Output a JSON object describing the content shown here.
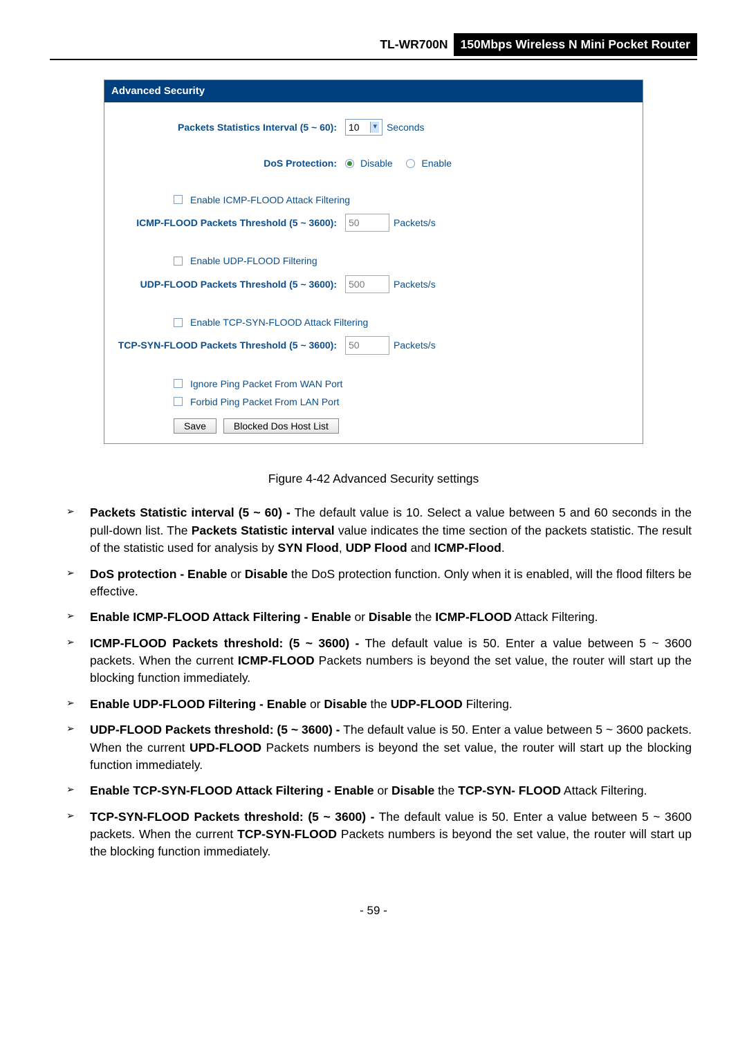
{
  "header": {
    "model": "TL-WR700N",
    "product": "150Mbps Wireless N Mini Pocket Router"
  },
  "panel": {
    "title": "Advanced Security",
    "interval_label": "Packets Statistics Interval (5 ~ 60):",
    "interval_value": "10",
    "interval_unit": "Seconds",
    "dos_label": "DoS Protection:",
    "dos_disable": "Disable",
    "dos_enable": "Enable",
    "icmp_chk": "Enable ICMP-FLOOD Attack Filtering",
    "icmp_thresh_label": "ICMP-FLOOD Packets Threshold (5 ~ 3600):",
    "icmp_thresh_val": "50",
    "udp_chk": "Enable UDP-FLOOD Filtering",
    "udp_thresh_label": "UDP-FLOOD Packets Threshold (5 ~ 3600):",
    "udp_thresh_val": "500",
    "tcp_chk": "Enable TCP-SYN-FLOOD Attack Filtering",
    "tcp_thresh_label": "TCP-SYN-FLOOD Packets Threshold (5 ~ 3600):",
    "tcp_thresh_val": "50",
    "pkt_unit": "Packets/s",
    "ignore_wan": "Ignore Ping Packet From WAN Port",
    "forbid_lan": "Forbid Ping Packet From LAN Port",
    "btn_save": "Save",
    "btn_blocked": "Blocked Dos Host List"
  },
  "figure_caption": "Figure 4-42 Advanced Security settings",
  "bullets": {
    "b1_a": "Packets Statistic interval (5 ~ 60) -",
    "b1_b": " The default value is 10. Select a value between 5 and 60 seconds in the pull-down list. The ",
    "b1_c": "Packets Statistic interval",
    "b1_d": " value indicates the time section of the packets statistic. The result of the statistic used for analysis by ",
    "b1_e": "SYN Flood",
    "b1_f": ", ",
    "b1_g": "UDP Flood",
    "b1_h": " and ",
    "b1_i": "ICMP-Flood",
    "b1_j": ".",
    "b2_a": "DoS protection - Enable",
    "b2_b": " or ",
    "b2_c": "Disable",
    "b2_d": " the DoS protection function. Only when it is enabled, will the flood filters be effective.",
    "b3_a": "Enable ICMP-FLOOD Attack Filtering - Enable",
    "b3_b": " or ",
    "b3_c": "Disable",
    "b3_d": " the ",
    "b3_e": "ICMP-FLOOD",
    "b3_f": " Attack Filtering.",
    "b4_a": "ICMP-FLOOD Packets threshold: (5 ~ 3600) -",
    "b4_b": " The default value is 50. Enter a value between 5 ~ 3600 packets. When the current ",
    "b4_c": "ICMP-FLOOD",
    "b4_d": " Packets numbers is beyond the set value, the router will start up the blocking function immediately.",
    "b5_a": "Enable UDP-FLOOD Filtering - Enable",
    "b5_b": " or ",
    "b5_c": "Disable",
    "b5_d": " the ",
    "b5_e": "UDP-FLOOD",
    "b5_f": " Filtering.",
    "b6_a": "UDP-FLOOD Packets threshold: (5 ~ 3600) -",
    "b6_b": " The default value is 50. Enter a value between 5 ~ 3600 packets. When the current ",
    "b6_c": "UPD-FLOOD",
    "b6_d": " Packets numbers is beyond the set value, the router will start up the blocking function immediately.",
    "b7_a": "Enable TCP-SYN-FLOOD Attack Filtering - Enable",
    "b7_b": " or ",
    "b7_c": "Disable",
    "b7_d": " the ",
    "b7_e": "TCP-SYN- FLOOD",
    "b7_f": " Attack Filtering.",
    "b8_a": "TCP-SYN-FLOOD Packets threshold: (5 ~ 3600) -",
    "b8_b": " The default value is 50. Enter a value between 5 ~ 3600 packets. When the current ",
    "b8_c": "TCP-SYN-FLOOD",
    "b8_d": " Packets numbers is beyond the set value, the router will start up the blocking function immediately."
  },
  "page_number": "- 59 -"
}
